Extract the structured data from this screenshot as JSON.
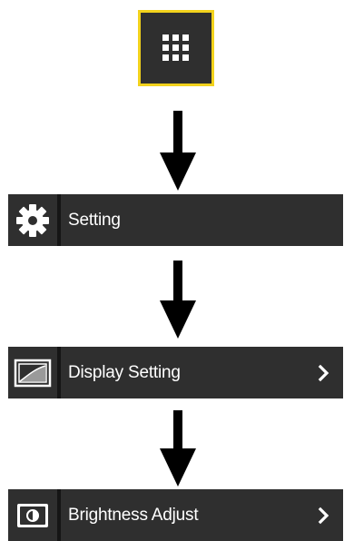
{
  "steps": [
    {
      "label": "Setting",
      "icon": "gear-icon",
      "has_chevron": false
    },
    {
      "label": "Display Setting",
      "icon": "display-image-icon",
      "has_chevron": true
    },
    {
      "label": "Brightness Adjust",
      "icon": "brightness-icon",
      "has_chevron": true
    }
  ],
  "grid_button": {
    "icon": "grid-menu-icon"
  },
  "colors": {
    "bar_background": "#2f2f2f",
    "highlight_border": "#f2d21c",
    "arrow": "#000000",
    "text": "#ffffff"
  }
}
